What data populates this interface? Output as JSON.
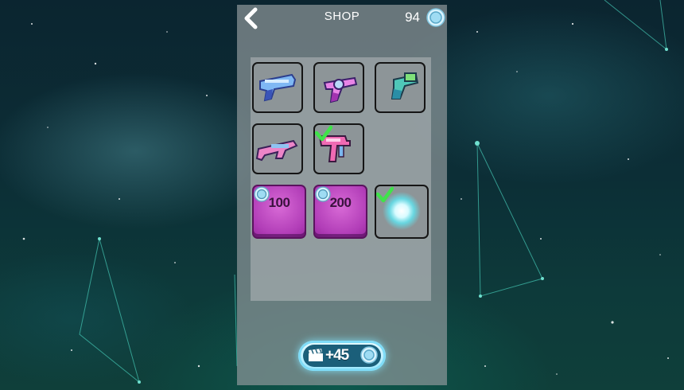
{
  "header": {
    "title": "SHOP",
    "coins": "94",
    "back_icon": "chevron-left-icon",
    "coin_icon": "coin-icon"
  },
  "shop": {
    "items": [
      {
        "name": "blue-pistol",
        "state": "owned"
      },
      {
        "name": "pink-revolver",
        "state": "owned"
      },
      {
        "name": "teal-flare-gun",
        "state": "owned"
      },
      {
        "name": "pink-blaster-rifle",
        "state": "owned"
      },
      {
        "name": "pink-uzi",
        "state": "selected"
      },
      {
        "name": "locked-weapon",
        "state": "locked",
        "price": "100"
      },
      {
        "name": "locked-weapon",
        "state": "locked",
        "price": "200"
      },
      {
        "name": "glowing-orb",
        "state": "selected"
      }
    ]
  },
  "reward": {
    "label": "+45",
    "icon": "clapperboard-icon"
  },
  "colors": {
    "locked_slot": "#b23eb8",
    "check": "#3fe34a",
    "coin": "#bfe9fb"
  }
}
